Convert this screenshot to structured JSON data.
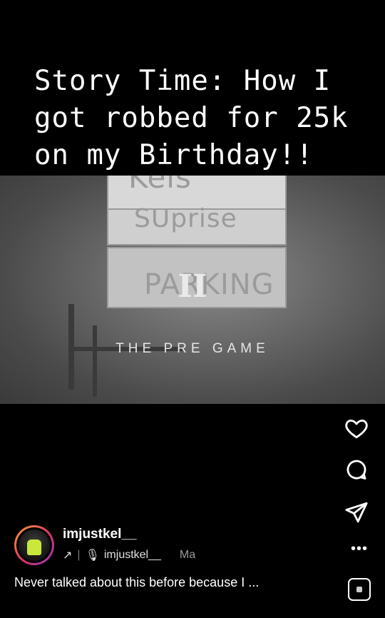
{
  "overlay": {
    "caption": "Story Time: How I\ngot robbed for 25k\non my Birthday!!"
  },
  "video": {
    "sign_lines": [
      "Kels",
      "SUprise",
      "PARKING"
    ],
    "numeral": "II",
    "subtitle": "THE PRE GAME"
  },
  "actions": {
    "like_icon": "heart-icon",
    "comment_icon": "comment-icon",
    "share_icon": "send-icon",
    "more_icon": "more-icon",
    "more_label": "•••"
  },
  "post": {
    "username": "imjustkel__",
    "repost_icon": "arrow-up-right-icon",
    "mic_icon": "microphone-icon",
    "audio_user": "imjustkel__",
    "audio_clip_text": "Ma",
    "description": "Never talked about this before because I ...",
    "accent_ring": "#e1306c"
  }
}
